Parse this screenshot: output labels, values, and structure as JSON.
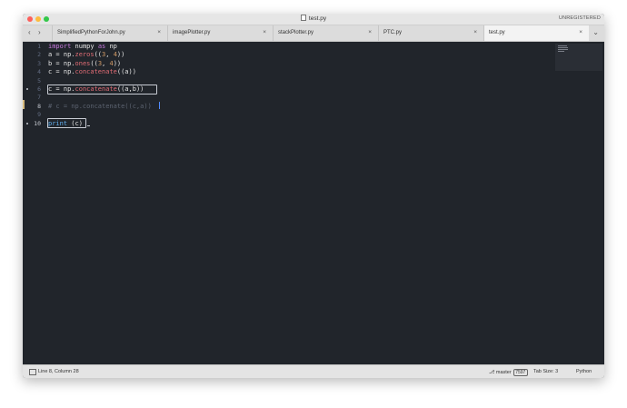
{
  "window": {
    "title": "test.py",
    "registration": "UNREGISTERED"
  },
  "tabs": [
    {
      "label": "SimplifiedPythonForJohn.py",
      "close": "×"
    },
    {
      "label": "imagePlotter.py",
      "close": "×"
    },
    {
      "label": "stackPlotter.py",
      "close": "×"
    },
    {
      "label": "PTC.py",
      "close": "×"
    },
    {
      "label": "test.py",
      "close": "×",
      "active": true
    }
  ],
  "nav": {
    "back": "‹",
    "forward": "›",
    "overflow": "⌄"
  },
  "editor": {
    "lines": [
      {
        "n": "1"
      },
      {
        "n": "2"
      },
      {
        "n": "3"
      },
      {
        "n": "4"
      },
      {
        "n": "5"
      },
      {
        "n": "6"
      },
      {
        "n": "7"
      },
      {
        "n": "8"
      },
      {
        "n": "9"
      },
      {
        "n": "10"
      }
    ],
    "code": {
      "l1_kw1": "import",
      "l1_mid": " numpy ",
      "l1_kw2": "as",
      "l1_end": " np",
      "l2_a": "a = np.",
      "l2_fn": "zeros",
      "l2_b": "((",
      "l2_n1": "3",
      "l2_c": ", ",
      "l2_n2": "4",
      "l2_d": "))",
      "l3_a": "b = np.",
      "l3_fn": "ones",
      "l3_b": "((",
      "l3_n1": "3",
      "l3_c": ", ",
      "l3_n2": "4",
      "l3_d": "))",
      "l4_a": "c = np.",
      "l4_fn": "concatenate",
      "l4_b": "((a))",
      "l6_a": "c = np.",
      "l6_fn": "concatenate",
      "l6_b": "((a,b))",
      "l8": "# c = np.concatenate((c,a))",
      "l10_fn": "print",
      "l10_b": " (c)"
    }
  },
  "status": {
    "position": "Line 8, Column 28",
    "branch": "master",
    "branch_badge": "7597",
    "tab_size": "Tab Size: 3",
    "language": "Python"
  }
}
